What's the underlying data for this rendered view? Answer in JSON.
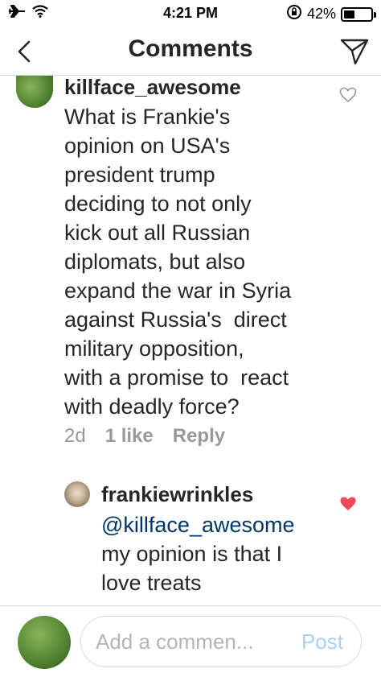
{
  "status_bar": {
    "time": "4:21 PM",
    "battery": "42%",
    "battery_level": 0.42,
    "icons": [
      "airplane-icon",
      "wifi-icon",
      "rotation-lock-icon",
      "battery-icon"
    ]
  },
  "header": {
    "title": "Comments",
    "back_icon": "chevron-left-icon",
    "send_icon": "paper-plane-icon"
  },
  "comments": [
    {
      "username": "killface_awesome",
      "text_lines": [
        "What is Frankie's",
        "opinion on USA's",
        "president trump",
        "deciding to not only",
        "kick out all Russian",
        "diplomats, but also",
        "expand the war in Syria",
        "against Russia's  direct",
        "military opposition,",
        "with a promise to  react",
        "with deadly force?"
      ],
      "age": "2d",
      "likes": "1 like",
      "reply": "Reply",
      "liked": false
    },
    {
      "username": "frankiewrinkles",
      "mention": "@killface_awesome",
      "text_lines": [
        "my opinion is that I",
        "love treats"
      ],
      "liked": true,
      "heart_color": "#ed4956"
    }
  ],
  "composer": {
    "placeholder": "Add a commen...",
    "post_label": "Post"
  }
}
